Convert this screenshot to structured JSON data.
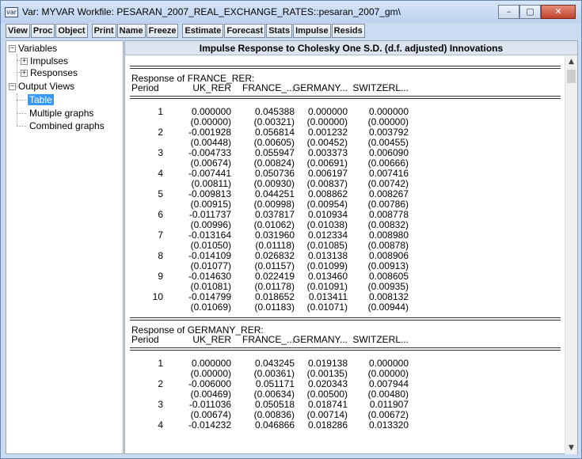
{
  "window": {
    "title": "Var: MYVAR   Workfile: PESARAN_2007_REAL_EXCHANGE_RATES::pesaran_2007_gm\\",
    "icon": "var-icon",
    "icon_text": "var",
    "min": "–",
    "max": "▢",
    "close": "✕"
  },
  "toolbar": {
    "group1": [
      "View",
      "Proc",
      "Object"
    ],
    "group2": [
      "Print",
      "Name",
      "Freeze"
    ],
    "group3": [
      "Estimate",
      "Forecast",
      "Stats",
      "Impulse",
      "Resids"
    ]
  },
  "tree": {
    "variables": "Variables",
    "impulses": "Impulses",
    "responses": "Responses",
    "output_views": "Output Views",
    "table": "Table",
    "multiple_graphs": "Multiple graphs",
    "combined_graphs": "Combined graphs",
    "collapse_glyph": "−",
    "expand_glyph": "+"
  },
  "main": {
    "header": "Impulse Response to Cholesky One S.D. (d.f. adjusted) Innovations",
    "columns": [
      "Period",
      "UK_RER",
      "FRANCE_...",
      "GERMANY...",
      "SWITZERL..."
    ],
    "blocks": [
      {
        "title": "Response of FRANCE_RER:",
        "rows": [
          {
            "p": "1",
            "v": [
              "0.000000",
              "0.045388",
              "0.000000",
              "0.000000"
            ],
            "se": [
              "(0.00000)",
              "(0.00321)",
              "(0.00000)",
              "(0.00000)"
            ]
          },
          {
            "p": "2",
            "v": [
              "-0.001928",
              "0.056814",
              "0.001232",
              "0.003792"
            ],
            "se": [
              "(0.00448)",
              "(0.00605)",
              "(0.00452)",
              "(0.00455)"
            ]
          },
          {
            "p": "3",
            "v": [
              "-0.004733",
              "0.055947",
              "0.003373",
              "0.006090"
            ],
            "se": [
              "(0.00674)",
              "(0.00824)",
              "(0.00691)",
              "(0.00666)"
            ]
          },
          {
            "p": "4",
            "v": [
              "-0.007441",
              "0.050736",
              "0.006197",
              "0.007416"
            ],
            "se": [
              "(0.00811)",
              "(0.00930)",
              "(0.00837)",
              "(0.00742)"
            ]
          },
          {
            "p": "5",
            "v": [
              "-0.009813",
              "0.044251",
              "0.008862",
              "0.008267"
            ],
            "se": [
              "(0.00915)",
              "(0.00998)",
              "(0.00954)",
              "(0.00786)"
            ]
          },
          {
            "p": "6",
            "v": [
              "-0.011737",
              "0.037817",
              "0.010934",
              "0.008778"
            ],
            "se": [
              "(0.00996)",
              "(0.01062)",
              "(0.01038)",
              "(0.00832)"
            ]
          },
          {
            "p": "7",
            "v": [
              "-0.013164",
              "0.031960",
              "0.012334",
              "0.008980"
            ],
            "se": [
              "(0.01050)",
              "(0.01118)",
              "(0.01085)",
              "(0.00878)"
            ]
          },
          {
            "p": "8",
            "v": [
              "-0.014109",
              "0.026832",
              "0.013138",
              "0.008906"
            ],
            "se": [
              "(0.01077)",
              "(0.01157)",
              "(0.01099)",
              "(0.00913)"
            ]
          },
          {
            "p": "9",
            "v": [
              "-0.014630",
              "0.022419",
              "0.013460",
              "0.008605"
            ],
            "se": [
              "(0.01081)",
              "(0.01178)",
              "(0.01091)",
              "(0.00935)"
            ]
          },
          {
            "p": "10",
            "v": [
              "-0.014799",
              "0.018652",
              "0.013411",
              "0.008132"
            ],
            "se": [
              "(0.01069)",
              "(0.01183)",
              "(0.01071)",
              "(0.00944)"
            ]
          }
        ]
      },
      {
        "title": "Response of GERMANY_RER:",
        "rows": [
          {
            "p": "1",
            "v": [
              "0.000000",
              "0.043245",
              "0.019138",
              "0.000000"
            ],
            "se": [
              "(0.00000)",
              "(0.00361)",
              "(0.00135)",
              "(0.00000)"
            ]
          },
          {
            "p": "2",
            "v": [
              "-0.006000",
              "0.051171",
              "0.020343",
              "0.007944"
            ],
            "se": [
              "(0.00469)",
              "(0.00634)",
              "(0.00500)",
              "(0.00480)"
            ]
          },
          {
            "p": "3",
            "v": [
              "-0.011036",
              "0.050518",
              "0.018741",
              "0.011907"
            ],
            "se": [
              "(0.00674)",
              "(0.00836)",
              "(0.00714)",
              "(0.00672)"
            ]
          },
          {
            "p": "4",
            "v": [
              "-0.014232",
              "0.046866",
              "0.018286",
              "0.013320"
            ],
            "se": [
              "",
              "",
              "",
              ""
            ]
          }
        ]
      }
    ]
  }
}
